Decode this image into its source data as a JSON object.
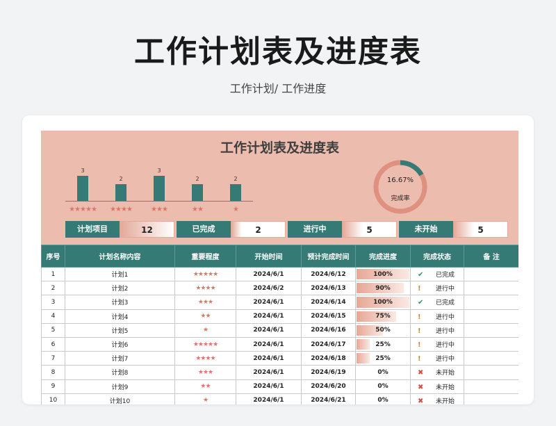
{
  "title": "工作计划表及进度表",
  "subtitle": "工作计划/  工作进度",
  "dashboard": {
    "title": "工作计划表及进度表",
    "bars": [
      {
        "value": 3,
        "stars": "★★★★★"
      },
      {
        "value": 2,
        "stars": "★★★★"
      },
      {
        "value": 3,
        "stars": "★★★"
      },
      {
        "value": 2,
        "stars": "★★"
      },
      {
        "value": 2,
        "stars": "★"
      }
    ],
    "donut": {
      "percent_text": "16.67%",
      "percent": 16.67,
      "label": "完成率"
    },
    "stats": [
      {
        "label": "计划项目",
        "value": "12"
      },
      {
        "label": "已完成",
        "value": "2"
      },
      {
        "label": "进行中",
        "value": "5"
      },
      {
        "label": "未开始",
        "value": "5"
      }
    ]
  },
  "table": {
    "headers": [
      "序号",
      "计划名称内容",
      "重要程度",
      "开始时间",
      "预计完成时间",
      "完成进度",
      "完成状态",
      "备 注"
    ],
    "rows": [
      {
        "no": "1",
        "name": "计划1",
        "stars": "★★★★★",
        "start": "2024/6/1",
        "end": "2024/6/12",
        "progress": "100%",
        "status": "已完成",
        "icon": "✔",
        "kind": "done",
        "note": ""
      },
      {
        "no": "2",
        "name": "计划2",
        "stars": "★★★★",
        "start": "2024/6/2",
        "end": "2024/6/13",
        "progress": "90%",
        "status": "进行中",
        "icon": "!",
        "kind": "prog",
        "note": ""
      },
      {
        "no": "3",
        "name": "计划3",
        "stars": "★★★",
        "start": "2024/6/1",
        "end": "2024/6/14",
        "progress": "100%",
        "status": "已完成",
        "icon": "✔",
        "kind": "done",
        "note": ""
      },
      {
        "no": "4",
        "name": "计划4",
        "stars": "★★",
        "start": "2024/6/1",
        "end": "2024/6/15",
        "progress": "75%",
        "status": "进行中",
        "icon": "!",
        "kind": "prog",
        "note": ""
      },
      {
        "no": "5",
        "name": "计划5",
        "stars": "★",
        "start": "2024/6/1",
        "end": "2024/6/16",
        "progress": "50%",
        "status": "进行中",
        "icon": "!",
        "kind": "prog",
        "note": ""
      },
      {
        "no": "6",
        "name": "计划6",
        "stars": "★★★★★",
        "start": "2024/6/1",
        "end": "2024/6/17",
        "progress": "25%",
        "status": "进行中",
        "icon": "!",
        "kind": "prog",
        "note": ""
      },
      {
        "no": "7",
        "name": "计划7",
        "stars": "★★★★",
        "start": "2024/6/1",
        "end": "2024/6/18",
        "progress": "25%",
        "status": "进行中",
        "icon": "!",
        "kind": "prog",
        "note": ""
      },
      {
        "no": "8",
        "name": "计划8",
        "stars": "★★★",
        "start": "2024/6/1",
        "end": "2024/6/19",
        "progress": "0%",
        "status": "未开始",
        "icon": "✖",
        "kind": "todo",
        "note": ""
      },
      {
        "no": "9",
        "name": "计划9",
        "stars": "★★",
        "start": "2024/6/1",
        "end": "2024/6/20",
        "progress": "0%",
        "status": "未开始",
        "icon": "✖",
        "kind": "todo",
        "note": ""
      },
      {
        "no": "10",
        "name": "计划10",
        "stars": "★",
        "start": "2024/6/1",
        "end": "2024/6/21",
        "progress": "0%",
        "status": "未开始",
        "icon": "✖",
        "kind": "todo",
        "note": ""
      }
    ]
  },
  "colors": {
    "accent": "#367a75",
    "background_pink": "#ecbcae",
    "star": "#d9776a",
    "progress": "#e7a795"
  }
}
